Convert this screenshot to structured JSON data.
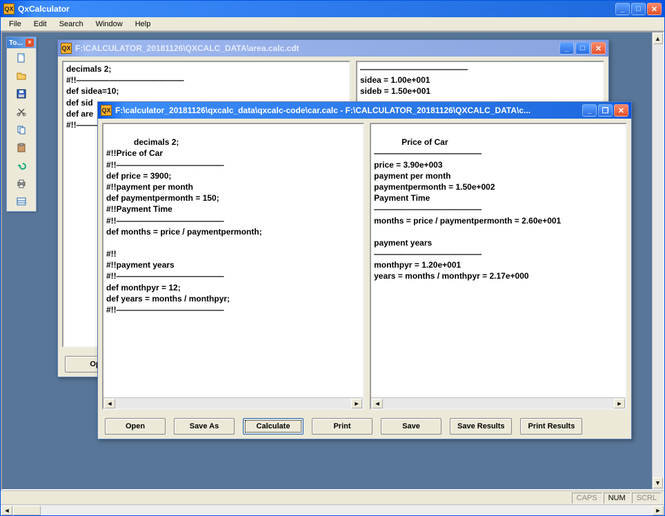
{
  "app": {
    "title": "QxCalculator",
    "icon_label": "QX"
  },
  "menu": {
    "file": "File",
    "edit": "Edit",
    "search": "Search",
    "window": "Window",
    "help": "Help"
  },
  "toolbox": {
    "title": "To..."
  },
  "bg_window": {
    "title": "F:\\CALCULATOR_20181126\\QXCALC_DATA\\area.calc.cdt",
    "left_text": "decimals 2;\n#!!—————————————\ndef sidea=10;\ndef sid\ndef are\n#!!———",
    "right_text": "—————————————\nsidea = 1.00e+001\nsideb = 1.50e+001",
    "open_btn": "Op"
  },
  "fg_window": {
    "title": "F:\\calculator_20181126\\qxcalc_data\\qxcalc-code\\car.calc - F:\\CALCULATOR_20181126\\QXCALC_DATA\\c...",
    "left_text": "decimals 2;\n#!!Price of Car\n#!!—————————————\ndef price = 3900;\n#!!payment per month\ndef paymentpermonth = 150;\n#!!Payment Time\n#!!—————————————\ndef months = price / paymentpermonth;\n\n#!!\n#!!payment years\n#!!—————————————\ndef monthpyr = 12;\ndef years = months / monthpyr;\n#!!—————————————",
    "right_text": "Price of Car\n—————————————\nprice = 3.90e+003\npayment per month\npaymentpermonth = 1.50e+002\nPayment Time\n—————————————\nmonths = price / paymentpermonth = 2.60e+001\n\npayment years\n—————————————\nmonthpyr = 1.20e+001\nyears = months / monthpyr = 2.17e+000",
    "buttons": {
      "open": "Open",
      "save_as": "Save As",
      "calculate": "Calculate",
      "print": "Print",
      "save": "Save",
      "save_results": "Save Results",
      "print_results": "Print Results"
    }
  },
  "status": {
    "caps": "CAPS",
    "num": "NUM",
    "scrl": "SCRL"
  }
}
